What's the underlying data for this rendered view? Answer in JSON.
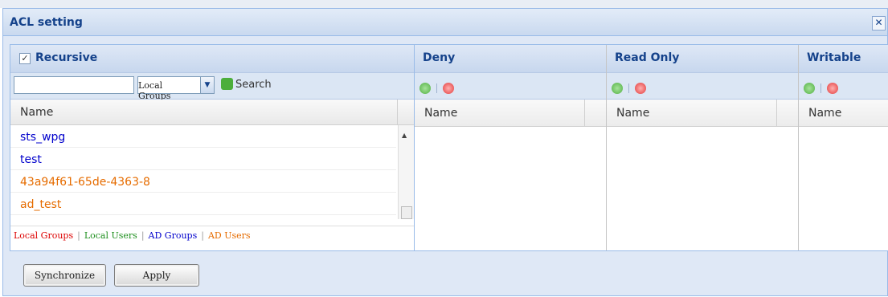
{
  "dialog": {
    "title": "ACL setting",
    "close_glyph": "✕"
  },
  "left": {
    "recursive_checked": true,
    "recursive_label": "Recursive",
    "search_value": "",
    "group_select_value": "Local Groups",
    "search_button": "Search",
    "column_name": "Name",
    "rows": [
      {
        "name": "sts_wpg",
        "type": "AD Groups"
      },
      {
        "name": "test",
        "type": "AD Groups"
      },
      {
        "name": "43a94f61-65de-4363-8",
        "type": "AD Users"
      },
      {
        "name": "ad_test",
        "type": "AD Users"
      }
    ],
    "legend": [
      {
        "label": "Local Groups",
        "color": "#dd0000"
      },
      {
        "label": "Local Users",
        "color": "#1e8f1e"
      },
      {
        "label": "AD Groups",
        "color": "#0000cc"
      },
      {
        "label": "AD Users",
        "color": "#e66c00"
      }
    ]
  },
  "permissions": [
    {
      "title": "Deny",
      "column_name": "Name"
    },
    {
      "title": "Read Only",
      "column_name": "Name"
    },
    {
      "title": "Writable",
      "column_name": "Name"
    }
  ],
  "footer": {
    "synchronize_label": "Synchronize",
    "apply_label": "Apply"
  },
  "colors": {
    "accent": "#15428b",
    "border": "#99bbe8"
  }
}
